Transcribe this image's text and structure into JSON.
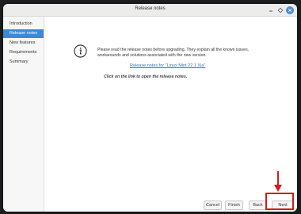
{
  "window": {
    "title": "Release notes"
  },
  "sidebar": {
    "items": [
      {
        "label": "Introduction",
        "active": false
      },
      {
        "label": "Release notes",
        "active": true
      },
      {
        "label": "New features",
        "active": false
      },
      {
        "label": "Requirements",
        "active": false
      },
      {
        "label": "Summary",
        "active": false
      }
    ]
  },
  "main": {
    "intro_text": "Please read the release notes before upgrading. They explain all the known issues, workarounds and solutions associated with the new version.",
    "link_text": "Release notes for \"Linux Mint 22.1 Xia\"",
    "hint_text": "Click on the link to open the release notes."
  },
  "buttons": {
    "cancel": "Cancel",
    "finish": "Finish",
    "back": "Back",
    "next": "Next"
  },
  "colors": {
    "accent": "#3b8ad8",
    "link": "#2a78c8",
    "highlight": "#d41b1b"
  },
  "icons": [
    "minimize-icon",
    "maximize-icon",
    "close-icon",
    "info-icon",
    "arrow-down-icon"
  ]
}
